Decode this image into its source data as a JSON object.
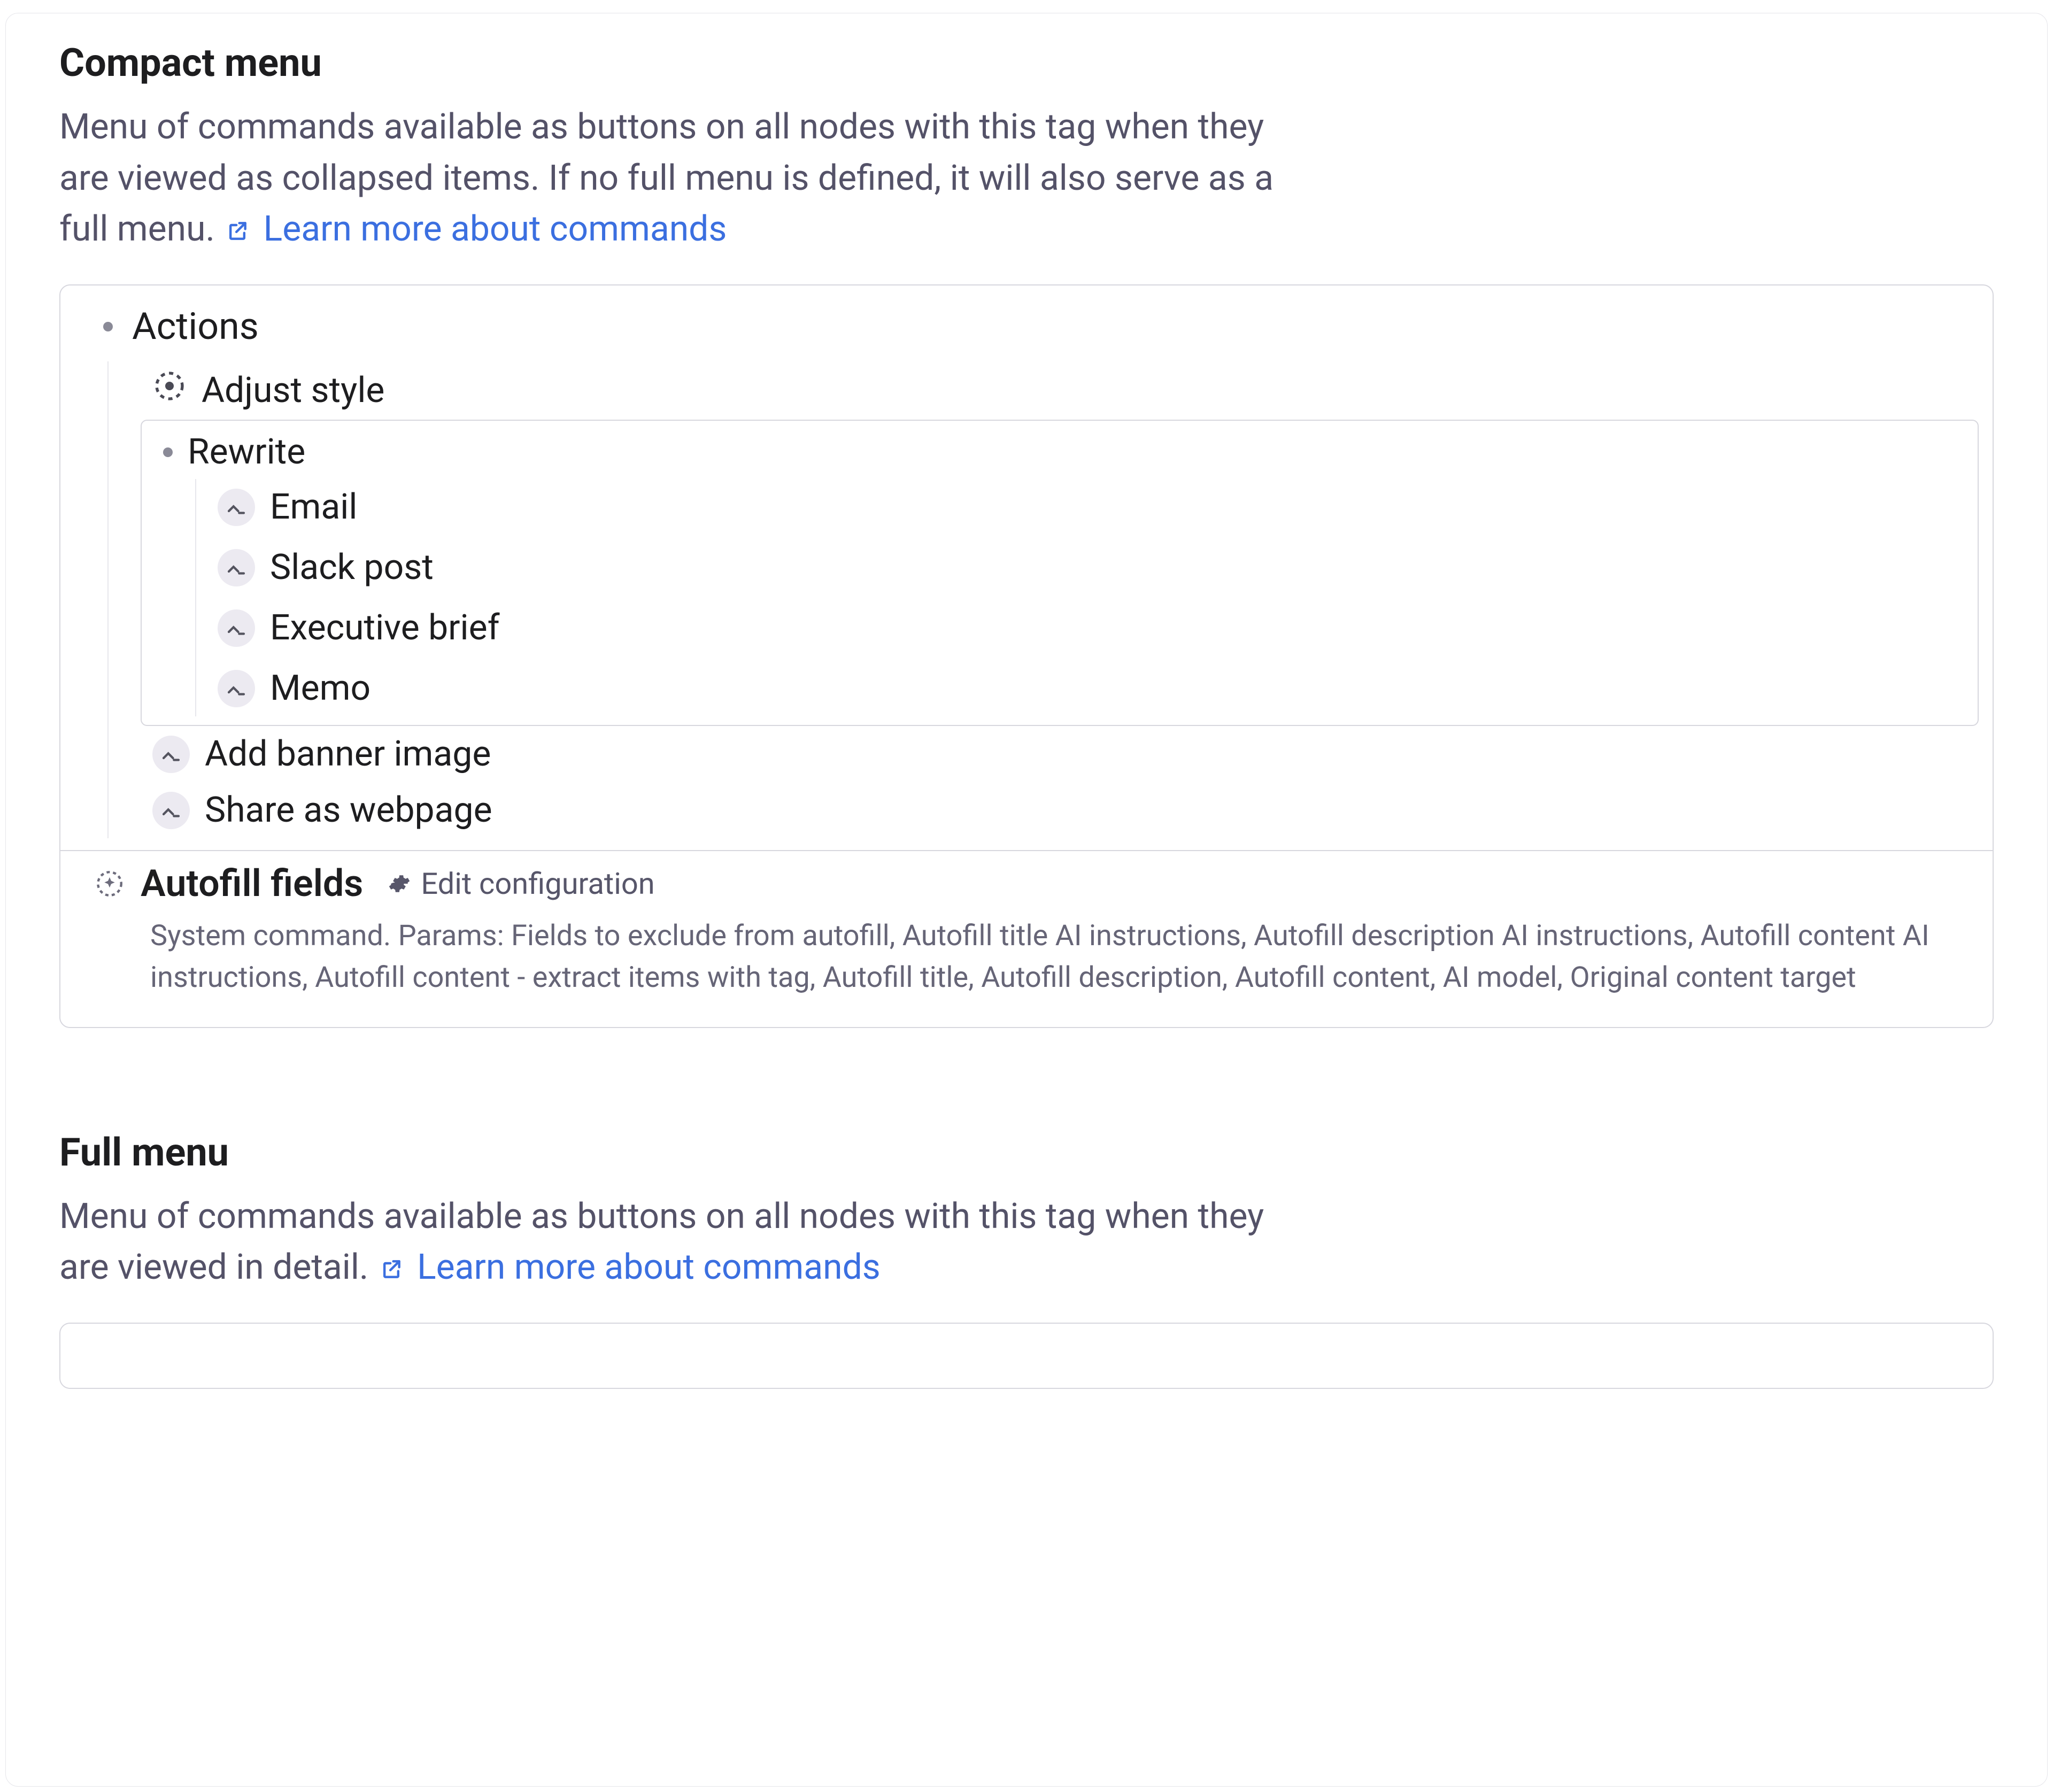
{
  "compact": {
    "title": "Compact menu",
    "desc": "Menu of commands available as buttons on all nodes with this tag when they are viewed as collapsed items. If no full menu is defined, it will also serve as a full menu.",
    "link": "Learn more about commands",
    "tree": {
      "actions": {
        "label": "Actions",
        "adjust_style": "Adjust style",
        "rewrite": {
          "label": "Rewrite",
          "items": [
            "Email",
            "Slack post",
            "Executive brief",
            "Memo"
          ]
        },
        "add_banner": "Add banner image",
        "share_webpage": "Share as webpage"
      }
    },
    "autofill": {
      "title": "Autofill fields",
      "edit_label": "Edit configuration",
      "desc": "System command. Params: Fields to exclude from autofill, Autofill title AI instructions, Autofill description AI instructions, Autofill content AI instructions, Autofill content - extract items with tag, Autofill title, Autofill description, Autofill content, AI model, Original content target"
    }
  },
  "full": {
    "title": "Full menu",
    "desc": "Menu of commands available as buttons on all nodes with this tag when they are viewed in detail.",
    "link": "Learn more about commands"
  }
}
